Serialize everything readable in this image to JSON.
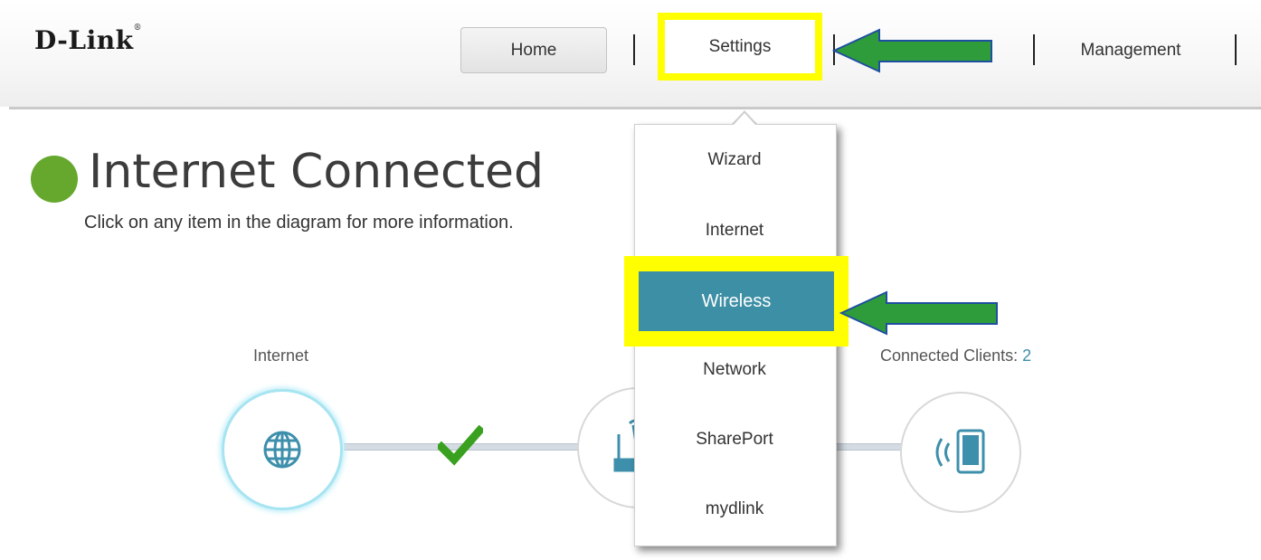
{
  "brand": {
    "logo_text": "D-Link",
    "logo_mark": "®"
  },
  "nav": {
    "home_label": "Home",
    "settings_label": "Settings",
    "management_label": "Management"
  },
  "status": {
    "title": "Internet Connected",
    "subtitle": "Click on any item in the diagram for more information.",
    "color": "#66a82d"
  },
  "diagram": {
    "internet_label": "Internet",
    "clients_label": "Connected Clients: ",
    "clients_count": "2",
    "accent_color": "#3d8fab",
    "check_color": "#3aa01f"
  },
  "settings_menu": {
    "items": [
      "Wizard",
      "Internet",
      "Wireless",
      "Network",
      "SharePort",
      "mydlink"
    ],
    "selected": "Wireless",
    "selected_color": "#3d8fa5"
  },
  "annotations": {
    "highlight_color": "#ffff00",
    "arrow_color": "#2e9c3a"
  }
}
